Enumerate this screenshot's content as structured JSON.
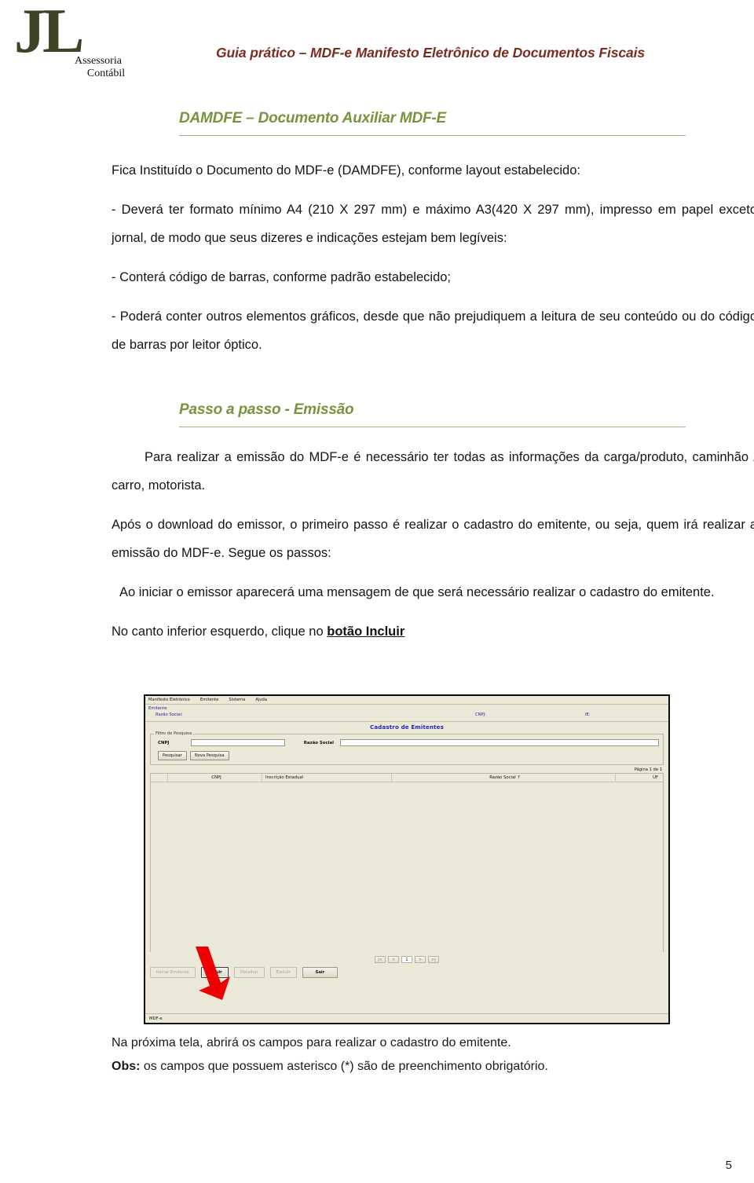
{
  "header": {
    "logo": {
      "mark": "JL",
      "line1": "Assessoria",
      "line2": "Contábil"
    },
    "title": "Guia prático –  MDF-e  Manifesto Eletrônico de Documentos Fiscais",
    "title_color": "#7b2c20"
  },
  "sections": {
    "damdfe": {
      "title": "DAMDFE – Documento Auxiliar MDF-E",
      "color": "#77933c",
      "paragraphs": {
        "p1": "Fica Instituído o Documento do MDF-e (DAMDFE), conforme layout estabelecido:",
        "p2": "- Deverá ter formato mínimo A4 (210 X 297 mm) e máximo A3(420 X 297 mm), impresso em papel exceto jornal, de modo que seus dizeres e indicações estejam bem legíveis:",
        "p3": "- Conterá código de barras, conforme padrão estabelecido;",
        "p4": "- Poderá conter outros elementos gráficos, desde que não prejudiquem a leitura de seu conteúdo ou do código de barras por leitor óptico."
      }
    },
    "passo": {
      "title": "Passo a passo - Emissão",
      "color": "#77933c",
      "paragraphs": {
        "p1": "Para realizar a emissão do MDF-e é necessário ter todas as informações da carga/produto, caminhão / carro, motorista.",
        "p2": "Após o download do emissor, o primeiro passo é realizar o cadastro do emitente, ou seja, quem irá realizar a emissão do MDF-e. Segue os passos:",
        "p3": "Ao iniciar o emissor aparecerá uma mensagem de que será necessário realizar o cadastro do emitente.",
        "p4_prefix": "No canto inferior esquerdo, clique no ",
        "p4_bold": "botão Incluir"
      }
    },
    "footer_notes": {
      "line1": "Na próxima tela, abrirá os campos para realizar o cadastro do emitente.",
      "line2_bold": "Obs:",
      "line2_rest": " os campos que possuem asterisco (*) são de preenchimento obrigatório."
    }
  },
  "app_screenshot": {
    "menubar": [
      "Manifesto Eletrônico",
      "Emitente",
      "Sistema",
      "Ajuda"
    ],
    "emitente_panel": {
      "group_label": "Emitente",
      "razao_label": "Razão Social:",
      "cnpj_label": "CNPJ:",
      "ie_label": "IE:"
    },
    "page_title": "Cadastro de Emitentes",
    "filter": {
      "legend": "Filtro de Pesquisa",
      "cnpj_label": "CNPJ",
      "cnpj_value": "",
      "razao_label": "Razão Social",
      "razao_value": "",
      "btn_pesquisar": "Pesquisar",
      "btn_nova": "Nova Pesquisa"
    },
    "page_info": "Página 1 de 1",
    "table_headers": [
      "",
      "CNPJ",
      "Inscrição Estadual",
      "Razão Social ↑",
      "UF"
    ],
    "pager": [
      "|<",
      "<",
      "1",
      ">",
      ">|"
    ],
    "pager_current": "1",
    "footer_buttons": [
      {
        "label": "Iniciar Emitente",
        "state": "disabled"
      },
      {
        "label": "Incluir",
        "state": "focused"
      },
      {
        "label": "Detalhar",
        "state": "disabled"
      },
      {
        "label": "Excluir",
        "state": "disabled"
      },
      {
        "label": "Sair",
        "state": "normal"
      }
    ],
    "status_bar": "MDF-e",
    "annotation_arrow_color": "#ee0000"
  },
  "page_number": "5"
}
